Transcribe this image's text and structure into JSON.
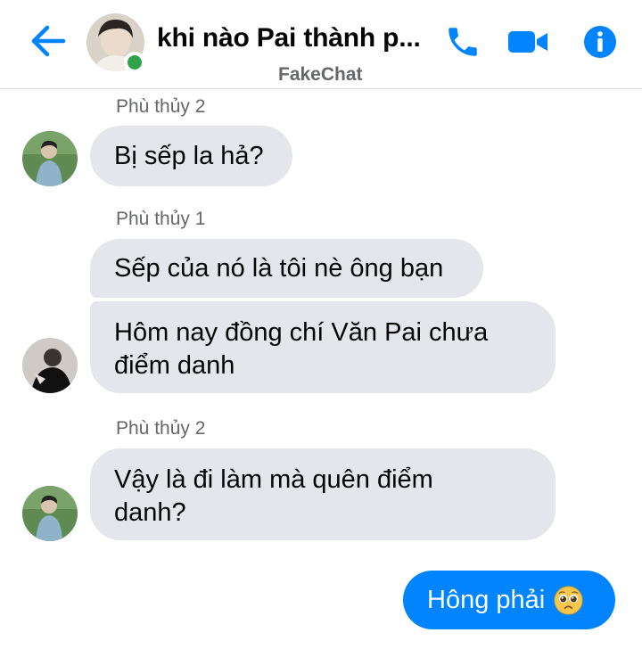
{
  "header": {
    "back_icon": "arrow-left-icon",
    "title": "khi nào Pai thành p...",
    "subtitle": "FakeChat",
    "online_status_color": "#31a24c",
    "actions": {
      "call_icon": "phone-icon",
      "video_icon": "video-camera-icon",
      "info_icon": "info-icon"
    },
    "accent_color": "#0084ff"
  },
  "messages": [
    {
      "sender": "Phù thủy 2",
      "texts": [
        "Bị sếp la hả?"
      ]
    },
    {
      "sender": "Phù thủy 1",
      "texts": [
        "Sếp của nó là tôi nè ông bạn",
        "Hôm nay đồng chí Văn Pai chưa điểm danh"
      ]
    },
    {
      "sender": "Phù thủy 2",
      "texts": [
        "Vậy là đi làm mà quên điểm danh?"
      ]
    }
  ],
  "outgoing": {
    "text": "Hông phải",
    "emoji_icon": "pleading-face-icon",
    "bubble_color": "#0084ff"
  },
  "incoming_bubble_color": "#e4e6eb"
}
